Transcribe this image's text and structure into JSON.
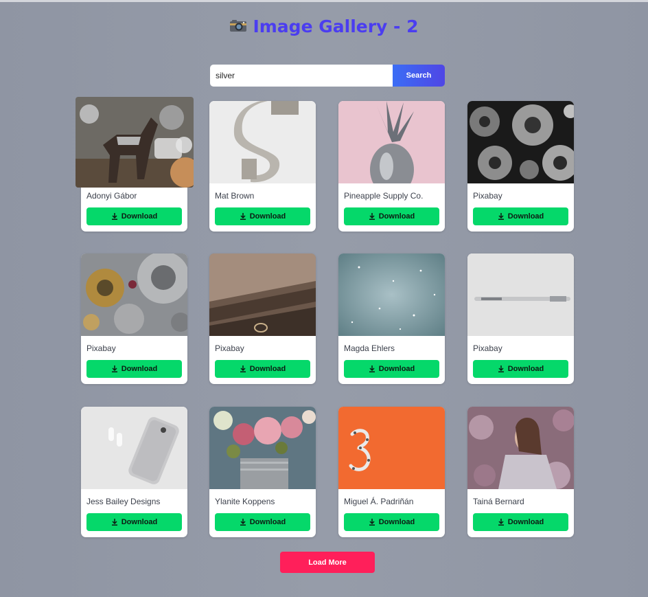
{
  "header": {
    "title": "Image Gallery - 2",
    "icon": "camera-icon"
  },
  "search": {
    "value": "silver",
    "button_label": "Search"
  },
  "download_label": "Download",
  "photos": [
    {
      "author": "Adonyi Gábor"
    },
    {
      "author": "Mat Brown"
    },
    {
      "author": "Pineapple Supply Co."
    },
    {
      "author": "Pixabay"
    },
    {
      "author": "Pixabay"
    },
    {
      "author": "Pixabay"
    },
    {
      "author": "Magda Ehlers"
    },
    {
      "author": "Pixabay"
    },
    {
      "author": "Jess Bailey Designs"
    },
    {
      "author": "Ylanite Koppens"
    },
    {
      "author": "Miguel Á. Padriñán"
    },
    {
      "author": "Tainá Bernard"
    }
  ],
  "load_more_label": "Load More",
  "colors": {
    "title": "#4b3df0",
    "download": "#05d86a",
    "load_more": "#ff1f5a",
    "search_button": "#3b6df5"
  }
}
